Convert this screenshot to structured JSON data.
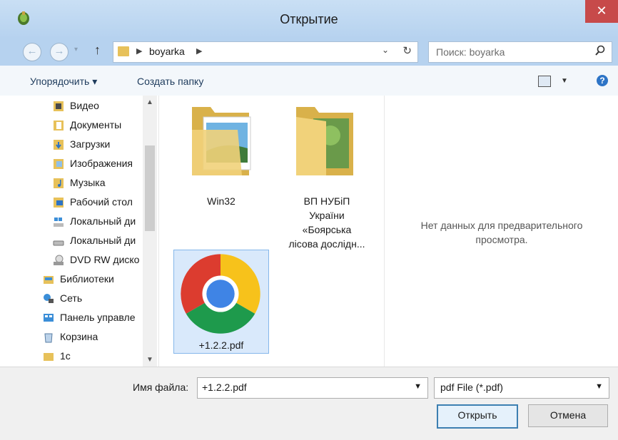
{
  "window": {
    "title": "Открытие",
    "close_glyph": "✕"
  },
  "nav": {
    "back": "←",
    "forward": "→",
    "up": "↑",
    "crumb": "boyarka",
    "refresh": "↻"
  },
  "search": {
    "placeholder": "Поиск: boyarka",
    "icon": "search-icon"
  },
  "toolbar": {
    "organize": "Упорядочить ▾",
    "new_folder": "Создать папку",
    "help": "?"
  },
  "sidebar": {
    "items": [
      {
        "label": "Видео",
        "icon": "video-folder-icon"
      },
      {
        "label": "Документы",
        "icon": "documents-folder-icon"
      },
      {
        "label": "Загрузки",
        "icon": "downloads-folder-icon"
      },
      {
        "label": "Изображения",
        "icon": "pictures-folder-icon"
      },
      {
        "label": "Музыка",
        "icon": "music-folder-icon"
      },
      {
        "label": "Рабочий стол",
        "icon": "desktop-folder-icon"
      },
      {
        "label": "Локальный ди",
        "icon": "local-disk-icon"
      },
      {
        "label": "Локальный ди",
        "icon": "local-disk-icon"
      },
      {
        "label": "DVD RW диско",
        "icon": "dvd-drive-icon"
      },
      {
        "label": "Библиотеки",
        "icon": "libraries-icon"
      },
      {
        "label": "Сеть",
        "icon": "network-icon"
      },
      {
        "label": "Панель управле",
        "icon": "control-panel-icon"
      },
      {
        "label": "Корзина",
        "icon": "recycle-bin-icon"
      },
      {
        "label": "1с",
        "icon": "folder-icon"
      }
    ]
  },
  "files": [
    {
      "name": "Win32",
      "icon": "folder-with-image-icon"
    },
    {
      "name_lines": [
        "ВП НУБіП",
        "України",
        "«Боярська",
        "лісова дослідн..."
      ],
      "icon": "folder-with-photo-icon"
    },
    {
      "name": "+1.2.2.pdf",
      "icon": "chrome-icon",
      "selected": true
    }
  ],
  "preview": {
    "text": "Нет данных для предварительного просмотра."
  },
  "bottom": {
    "filename_label": "Имя файла:",
    "filename_value": "+1.2.2.pdf",
    "filetype": "pdf File (*.pdf)",
    "open_label": "Открыть",
    "cancel_label": "Отмена"
  },
  "colors": {
    "titlebar": "#b6d2ef",
    "close": "#c74a4a",
    "selection": "#d9e9fb",
    "folder": "#e7c15a"
  }
}
